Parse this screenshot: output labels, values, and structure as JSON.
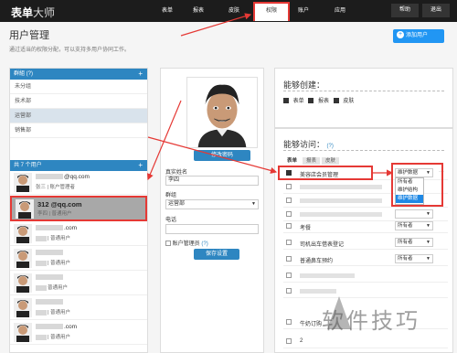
{
  "app": {
    "brand_main": "表单",
    "brand_sub": "大师"
  },
  "nav": {
    "items": [
      "表单",
      "报表",
      "皮肤",
      "权限",
      "账户",
      "应用"
    ],
    "active": "权限",
    "right": [
      "帮助",
      "退出"
    ]
  },
  "header": {
    "title": "用户管理",
    "subtitle": "通过适当的权限分配，可以支持多用户协同工作。",
    "add_button": "添加用户"
  },
  "groups": {
    "title": "群組 (?)",
    "items": [
      "未分组",
      "技术部",
      "运营部",
      "销售部"
    ],
    "selected": "运营部"
  },
  "users": {
    "title": "共 7 个用户",
    "list": [
      {
        "email": "@qq.com",
        "sub": "张三 | 账户管理者"
      },
      {
        "email": "312        @qq.com",
        "sub": "李四 | 普通用户"
      },
      {
        "email": ".com",
        "sub": "| 普通用户"
      },
      {
        "email": "",
        "sub": "| 普通用户"
      },
      {
        "email": "",
        "sub": "普通用户"
      },
      {
        "email": "",
        "sub": "| 普通用户"
      },
      {
        "email": ".com",
        "sub": "| 普通用户"
      }
    ]
  },
  "detail": {
    "change_avatar": "修改密码",
    "real_name_label": "真实姓名",
    "real_name_value": "李四",
    "group_label": "群组",
    "group_value": "运营部",
    "phone_label": "电话",
    "phone_value": "",
    "admin_label": "账户管理员",
    "admin_q": "(?)",
    "save": "保存设置"
  },
  "permissions": {
    "create_title": "能够创建：",
    "create_options": [
      "表单",
      "报表",
      "皮肤"
    ],
    "access_title": "能够访问：",
    "access_q": "(?)",
    "tabs": [
      "表单",
      "报表",
      "皮肤"
    ],
    "more": "···",
    "rows": [
      {
        "label": "美容店会员管理",
        "checked": true,
        "value": "维护数据"
      },
      {
        "label": "",
        "checked": false,
        "value": ""
      },
      {
        "label": "",
        "checked": false,
        "value": ""
      },
      {
        "label": "",
        "checked": false,
        "value": ""
      },
      {
        "label": "考餐",
        "checked": false,
        "value": "所有者"
      },
      {
        "label": "司机出车借表登记",
        "checked": false,
        "value": "所有者"
      },
      {
        "label": "普通鼻车预约",
        "checked": false,
        "value": "所有者"
      },
      {
        "label": "",
        "checked": false,
        "value": ""
      },
      {
        "label": "",
        "checked": false,
        "value": ""
      },
      {
        "label": "牛奶订购",
        "checked": false,
        "value": ""
      },
      {
        "label": "2",
        "checked": false,
        "value": ""
      }
    ],
    "dropdown_options": [
      "所有者",
      "维护结构",
      "维护数据"
    ],
    "dropdown_selected": "维护数据"
  },
  "watermark": "软件技巧"
}
